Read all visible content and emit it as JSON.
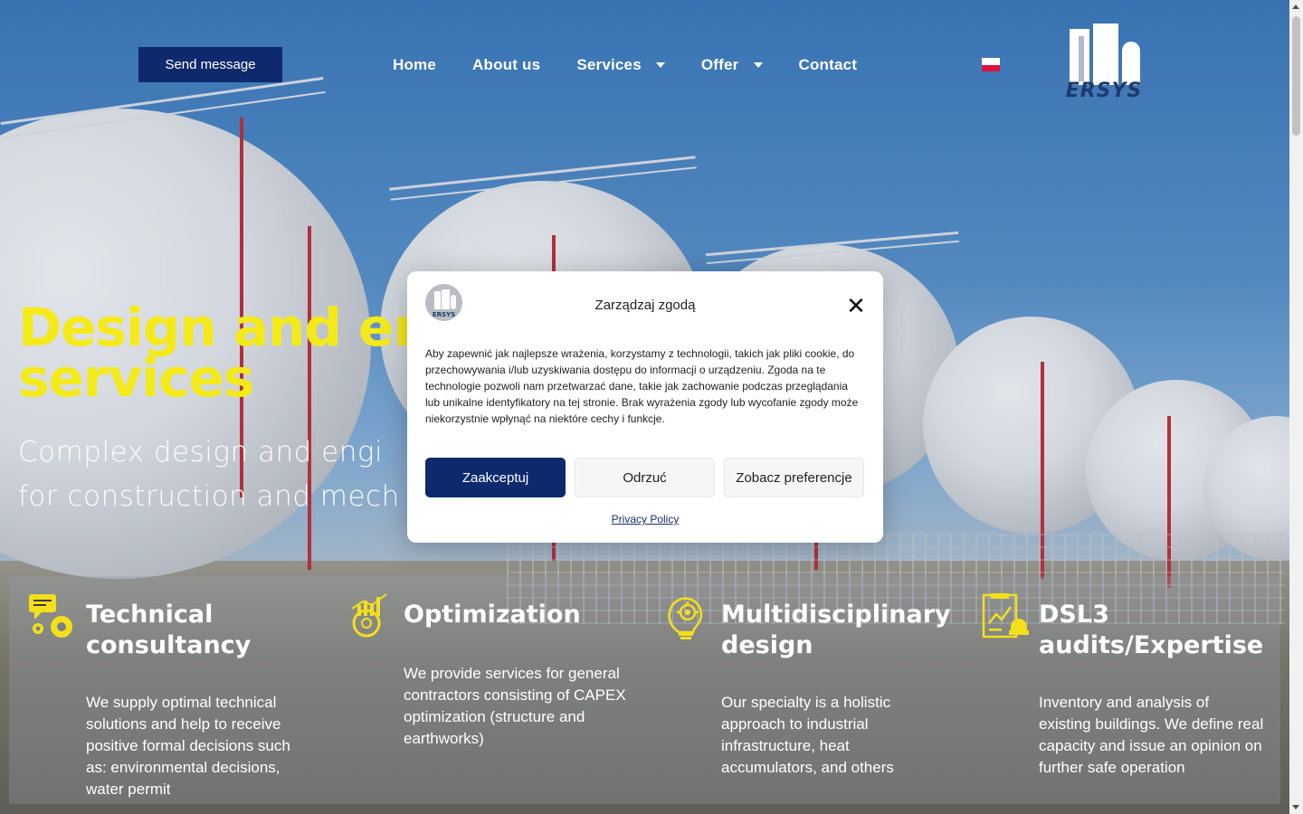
{
  "header": {
    "send_button_label": "Send message",
    "nav": {
      "home": "Home",
      "about": "About us",
      "services": "Services",
      "offer": "Offer",
      "contact": "Contact"
    },
    "logo_text": "ERSYS"
  },
  "hero": {
    "title": "Design and en                 services",
    "title_line1": "Design and en",
    "title_line2": "services",
    "subtitle_line1": "Complex design and engi",
    "subtitle_line2": "for construction and mech"
  },
  "features": [
    {
      "icon": "chat-gear-icon",
      "title": "Technical consultancy",
      "text": "We supply optimal technical solutions and help to receive positive formal decisions such as: environmental decisions, water permit"
    },
    {
      "icon": "optimization-chart-gear-icon",
      "title": "Optimization",
      "text": "We provide services for general contractors consisting of CAPEX optimization (structure and earthworks)"
    },
    {
      "icon": "lightbulb-gear-icon",
      "title": "Multidisciplinary design",
      "text": "Our specialty is a holistic approach to industrial infrastructure, heat accumulators, and others"
    },
    {
      "icon": "audit-document-icon",
      "title": "DSL3 audits/Expertise",
      "text": "Inventory and analysis of existing buildings. We define real capacity and issue an opinion on further safe operation"
    }
  ],
  "consent": {
    "title": "Zarządzaj zgodą",
    "text": "Aby zapewnić jak najlepsze wrażenia, korzystamy z technologii, takich jak pliki cookie, do przechowywania i/lub uzyskiwania dostępu do informacji o urządzeniu. Zgoda na te technologie pozwoli nam przetwarzać dane, takie jak zachowanie podczas przeglądania lub unikalne identyfikatory na tej stronie. Brak wyrażenia zgody lub wycofanie zgody może niekorzystnie wpłynąć na niektóre cechy i funkcje.",
    "accept_label": "Zaakceptuj",
    "deny_label": "Odrzuć",
    "prefs_label": "Zobacz preferencje",
    "privacy_label": "Privacy Policy",
    "logo_text": "ERSYS"
  },
  "colors": {
    "accent_navy": "#0e2a6d",
    "hero_yellow": "#f4ea1a",
    "icon_yellow": "#f4e01a"
  }
}
